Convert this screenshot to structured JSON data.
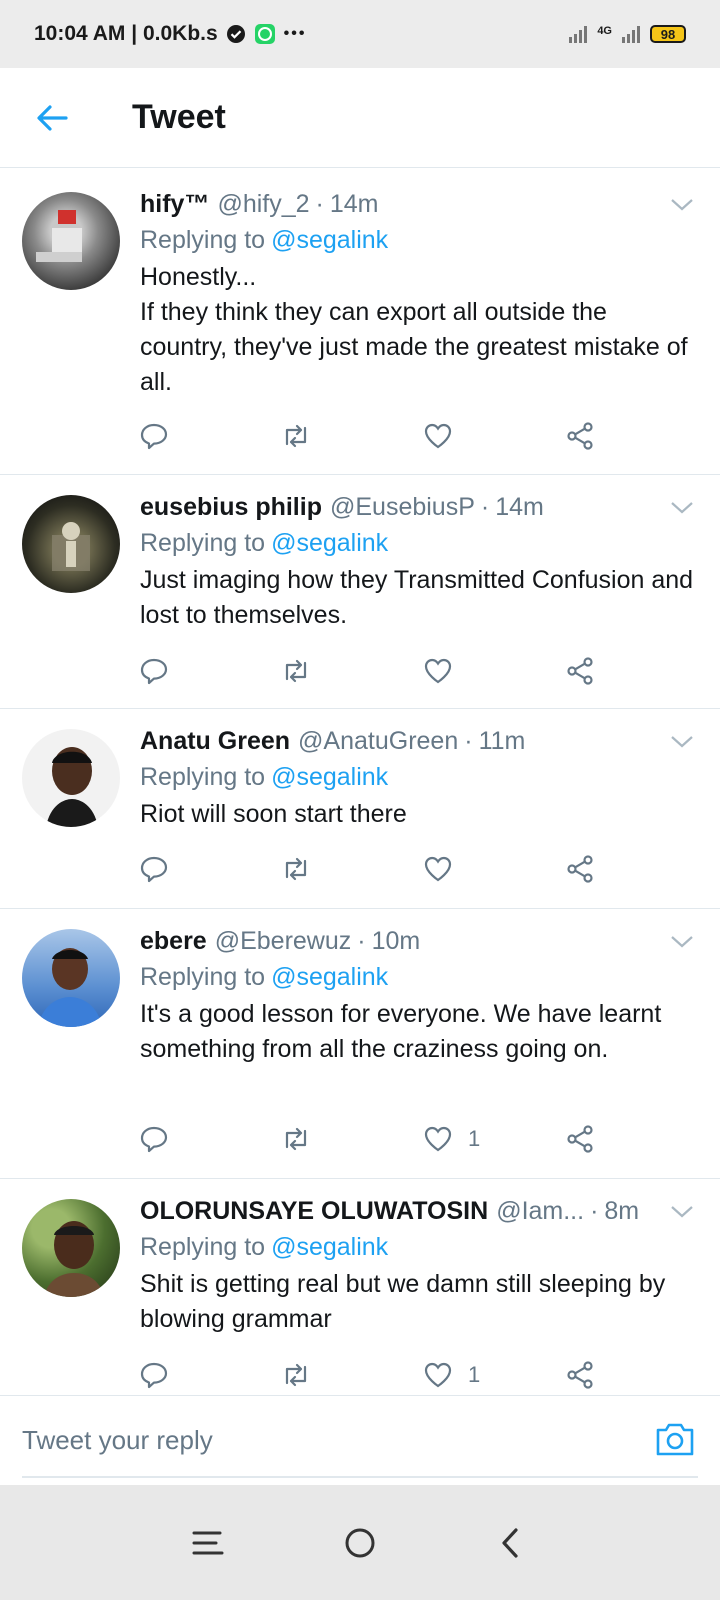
{
  "status_bar": {
    "time_info": "10:04 AM | 0.0Kb.s",
    "more": "•••",
    "network_label": "4G",
    "battery": "98"
  },
  "header": {
    "title": "Tweet"
  },
  "tweets": [
    {
      "name": "hify™",
      "handle": "@hify_2",
      "sep": "·",
      "time": "14m",
      "replying_prefix": "Replying to",
      "replying_to": "@segalink",
      "text": "Honestly...\nIf they think they can export all outside the country, they've just made the greatest mistake of all.",
      "likes": ""
    },
    {
      "name": "eusebius philip",
      "handle": "@EusebiusP",
      "sep": "·",
      "time": "14m",
      "replying_prefix": "Replying to",
      "replying_to": "@segalink",
      "text": "Just imaging how they Transmitted Confusion and lost to themselves.",
      "likes": ""
    },
    {
      "name": "Anatu Green",
      "handle": "@AnatuGreen",
      "sep": "·",
      "time": "11m",
      "replying_prefix": "Replying to",
      "replying_to": "@segalink",
      "text": "Riot will soon start there",
      "likes": ""
    },
    {
      "name": "ebere",
      "handle": "@Eberewuz",
      "sep": "·",
      "time": "10m",
      "replying_prefix": "Replying to",
      "replying_to": "@segalink",
      "text": "It's a good lesson for everyone. We have learnt something from all the craziness going on.",
      "likes": "1"
    },
    {
      "name": "OLORUNSAYE OLUWATOSIN",
      "handle": "@Iam...",
      "sep": "·",
      "time": "8m",
      "replying_prefix": "Replying to",
      "replying_to": "@segalink",
      "text": "Shit is getting real but we damn still sleeping by blowing grammar",
      "likes": "1"
    }
  ],
  "reply_bar": {
    "placeholder": "Tweet your reply"
  },
  "colors": {
    "accent": "#1da1f2",
    "text": "#14171a",
    "muted": "#657786",
    "border": "#e1e8ed"
  },
  "icons": [
    "back-arrow-icon",
    "chevron-down-icon",
    "reply-icon",
    "retweet-icon",
    "like-icon",
    "share-icon",
    "camera-icon",
    "menu-icon",
    "home-circle-icon",
    "back-chevron-icon"
  ]
}
